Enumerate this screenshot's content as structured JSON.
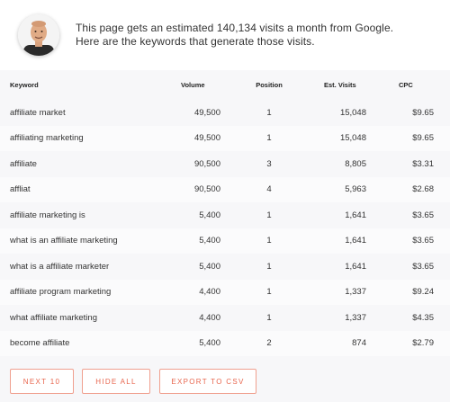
{
  "header": {
    "line1": "This page gets an estimated 140,134 visits a month from Google.",
    "line2": "Here are the keywords that generate those visits."
  },
  "table": {
    "columns": [
      "Keyword",
      "Volume",
      "Position",
      "Est. Visits",
      "CPC"
    ],
    "rows": [
      {
        "keyword": "affiliate market",
        "volume": "49,500",
        "position": "1",
        "visits": "15,048",
        "cpc": "$9.65"
      },
      {
        "keyword": "affiliating marketing",
        "volume": "49,500",
        "position": "1",
        "visits": "15,048",
        "cpc": "$9.65"
      },
      {
        "keyword": "affiliate",
        "volume": "90,500",
        "position": "3",
        "visits": "8,805",
        "cpc": "$3.31"
      },
      {
        "keyword": "affliat",
        "volume": "90,500",
        "position": "4",
        "visits": "5,963",
        "cpc": "$2.68"
      },
      {
        "keyword": "affiliate marketing is",
        "volume": "5,400",
        "position": "1",
        "visits": "1,641",
        "cpc": "$3.65"
      },
      {
        "keyword": "what is an affiliate marketing",
        "volume": "5,400",
        "position": "1",
        "visits": "1,641",
        "cpc": "$3.65"
      },
      {
        "keyword": "what is a affiliate marketer",
        "volume": "5,400",
        "position": "1",
        "visits": "1,641",
        "cpc": "$3.65"
      },
      {
        "keyword": "affiliate program marketing",
        "volume": "4,400",
        "position": "1",
        "visits": "1,337",
        "cpc": "$9.24"
      },
      {
        "keyword": "what affiliate marketing",
        "volume": "4,400",
        "position": "1",
        "visits": "1,337",
        "cpc": "$4.35"
      },
      {
        "keyword": "become affiliate",
        "volume": "5,400",
        "position": "2",
        "visits": "874",
        "cpc": "$2.79"
      }
    ]
  },
  "buttons": {
    "next": "NEXT 10",
    "hide": "HIDE ALL",
    "export": "EXPORT TO CSV"
  },
  "colors": {
    "accent": "#e8664e",
    "button_border": "#f0a08f",
    "table_bg": "#f7f7f9"
  },
  "icons": {
    "avatar": "author-avatar-icon"
  }
}
